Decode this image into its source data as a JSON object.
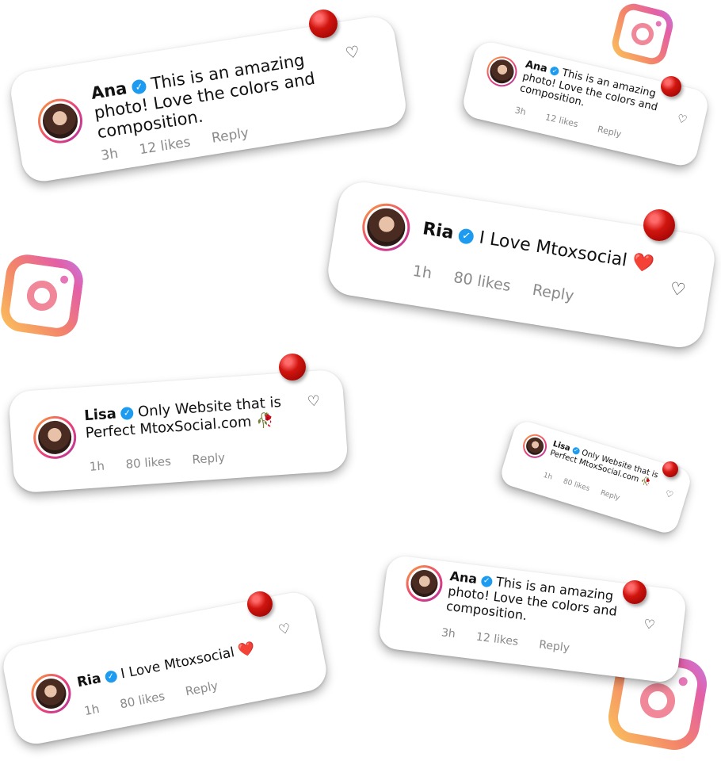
{
  "icons": {
    "instagram": "instagram-icon",
    "heart": "heart-outline-icon",
    "pin": "push-pin-icon",
    "verified": "verified-badge-icon"
  },
  "colors": {
    "verified": "#1d9bf0",
    "pin": "#d1150f",
    "meta_text": "#8a8a8a"
  },
  "comments": [
    {
      "name": "Ana",
      "text": "This is an amazing photo! Love the colors and composition.",
      "time": "3h",
      "likes": "12 likes",
      "reply": "Reply"
    },
    {
      "name": "Ana",
      "text": "This is an amazing photo! Love the colors and composition.",
      "time": "3h",
      "likes": "12 likes",
      "reply": "Reply"
    },
    {
      "name": "Ria",
      "text": "I Love Mtoxsocial ❤️",
      "time": "1h",
      "likes": "80 likes",
      "reply": "Reply"
    },
    {
      "name": "Lisa",
      "text": "Only Website that is Perfect MtoxSocial.com 🥀",
      "time": "1h",
      "likes": "80 likes",
      "reply": "Reply"
    },
    {
      "name": "Lisa",
      "text": "Only Website that is Perfect MtoxSocial.com 🥀",
      "time": "1h",
      "likes": "80 likes",
      "reply": "Reply"
    },
    {
      "name": "Ria",
      "text": "I Love Mtoxsocial ❤️",
      "time": "1h",
      "likes": "80 likes",
      "reply": "Reply"
    },
    {
      "name": "Ana",
      "text": "This is an amazing photo! Love the colors and composition.",
      "time": "3h",
      "likes": "12 likes",
      "reply": "Reply"
    }
  ]
}
